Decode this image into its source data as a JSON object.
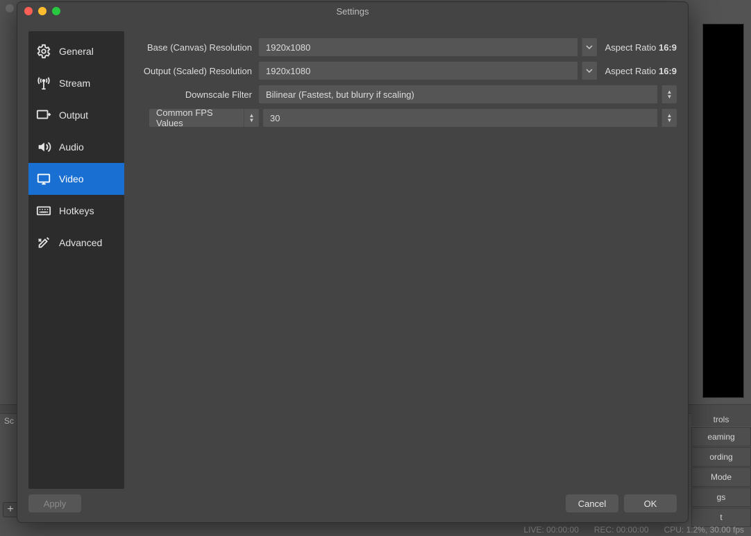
{
  "window": {
    "title": "Settings"
  },
  "sidebar": {
    "items": [
      {
        "label": "General"
      },
      {
        "label": "Stream"
      },
      {
        "label": "Output"
      },
      {
        "label": "Audio"
      },
      {
        "label": "Video"
      },
      {
        "label": "Hotkeys"
      },
      {
        "label": "Advanced"
      }
    ],
    "active_index": 4
  },
  "form": {
    "base_resolution_label": "Base (Canvas) Resolution",
    "base_resolution_value": "1920x1080",
    "base_aspect_prefix": "Aspect Ratio ",
    "base_aspect_value": "16:9",
    "output_resolution_label": "Output (Scaled) Resolution",
    "output_resolution_value": "1920x1080",
    "output_aspect_prefix": "Aspect Ratio ",
    "output_aspect_value": "16:9",
    "downscale_label": "Downscale Filter",
    "downscale_value": "Bilinear (Fastest, but blurry if scaling)",
    "fps_selector_label": "Common FPS Values",
    "fps_value": "30"
  },
  "footer": {
    "apply": "Apply",
    "cancel": "Cancel",
    "ok": "OK"
  },
  "background": {
    "controls_header": "trols",
    "buttons": [
      "eaming",
      "ording",
      "Mode",
      "gs",
      "t"
    ],
    "left_label": "Sc",
    "status_live": "LIVE: 00:00:00",
    "status_rec": "REC: 00:00:00",
    "status_cpu": "CPU: 1.2%, 30.00 fps"
  }
}
